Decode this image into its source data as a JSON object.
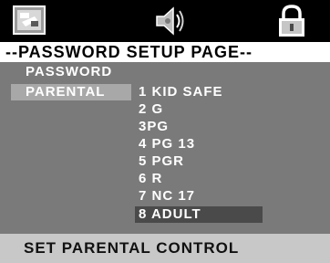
{
  "header": {
    "tabs": [
      {
        "name": "general-setup",
        "icon": "settings-panel-icon"
      },
      {
        "name": "audio-setup",
        "icon": "speaker-icon"
      },
      {
        "name": "password-setup",
        "icon": "padlock-icon",
        "active": true
      }
    ]
  },
  "page_title": "--PASSWORD SETUP PAGE--",
  "menu": {
    "items": [
      {
        "label": "PASSWORD"
      },
      {
        "label": "PARENTAL",
        "selected": true
      }
    ]
  },
  "parental_options": [
    {
      "label": "1 KID SAFE"
    },
    {
      "label": "2 G"
    },
    {
      "label": "3PG"
    },
    {
      "label": "4 PG 13"
    },
    {
      "label": "5 PGR"
    },
    {
      "label": "6 R"
    },
    {
      "label": "7 NC 17"
    },
    {
      "label": "8 ADULT",
      "selected": true
    }
  ],
  "status": "SET PARENTAL CONTROL",
  "colors": {
    "background": "#000000",
    "content_panel": "#7a7a7a",
    "menu_highlight": "#a8a8a8",
    "option_highlight": "#4a4a4a",
    "status_bar": "#c8c8c8"
  }
}
